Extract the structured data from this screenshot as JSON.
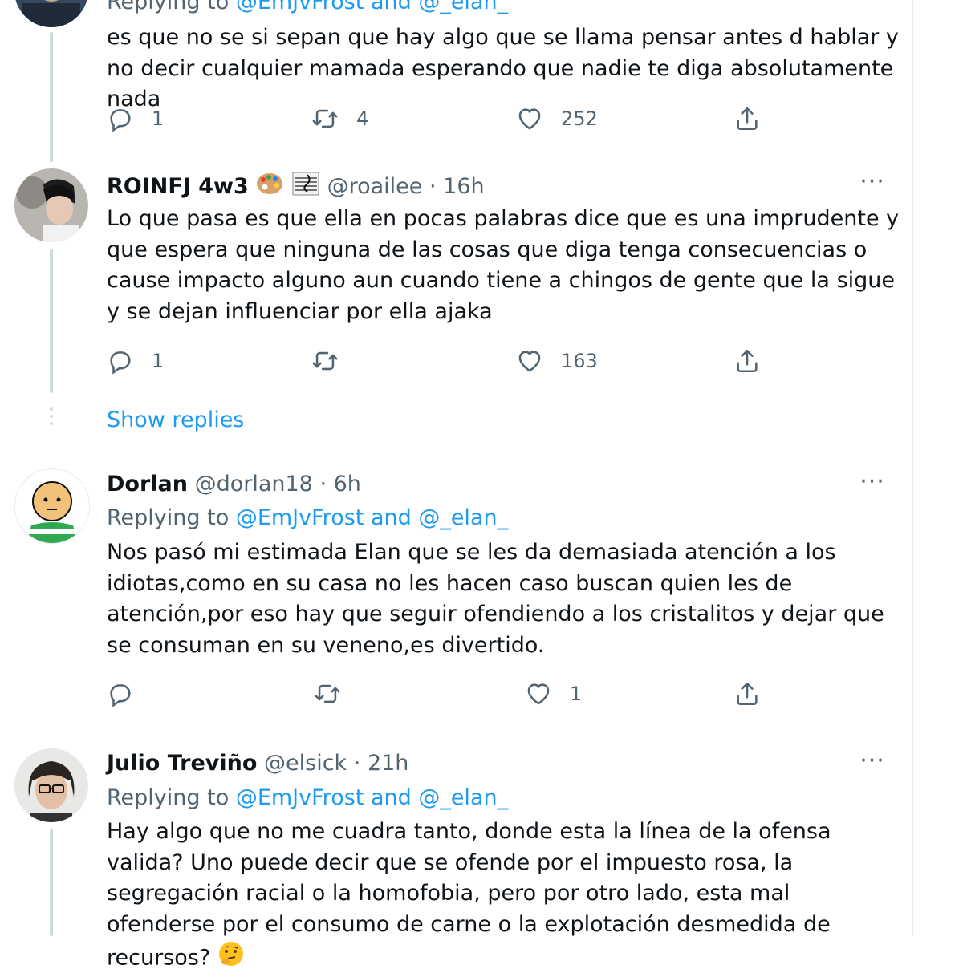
{
  "tweets": [
    {
      "replying_prefix": "Replying to ",
      "replying_to": "@EmJvFrost and @_elan_",
      "text": "es que no se si sepan que hay algo que se llama pensar antes d hablar y no decir cualquier mamada esperando que nadie te diga absolutamente nada",
      "replies": "1",
      "retweets": "4",
      "likes": "252"
    },
    {
      "name": "ROINFJ 4w3",
      "handle": "@roailee",
      "sep": " · ",
      "time": "16h",
      "text": "Lo que pasa es que ella en pocas palabras dice que es una imprudente y que espera que ninguna de las cosas que diga tenga consecuencias o cause impacto alguno aun cuando tiene a chingos de gente que la sigue y se dejan influenciar por ella ajaka",
      "replies": "1",
      "retweets": "",
      "likes": "163",
      "more": "···"
    },
    {
      "name": "Dorlan",
      "handle": "@dorlan18",
      "sep": " · ",
      "time": "6h",
      "replying_prefix": "Replying to ",
      "replying_to": "@EmJvFrost and @_elan_",
      "text": "Nos pasó mi estimada Elan que se les da demasiada atención a los idiotas,como en su casa no les hacen caso buscan quien les de atención,por eso hay que seguir ofendiendo a los cristalitos y dejar que se consuman en su veneno,es divertido.",
      "replies": "",
      "retweets": "",
      "likes": "1",
      "more": "···"
    },
    {
      "name": "Julio Treviño",
      "handle": "@elsick",
      "sep": " · ",
      "time": "21h",
      "replying_prefix": "Replying to ",
      "replying_to": "@EmJvFrost and @_elan_",
      "text": "Hay algo que no me cuadra tanto, donde esta la línea de la ofensa valida? Uno puede decir que se ofende por el impuesto rosa, la segregación racial o la homofobia, pero por otro lado, esta mal ofenderse por el consumo de carne o la explotación desmedida de recursos?",
      "more": "···"
    }
  ],
  "show_replies": "Show replies",
  "colors": {
    "accent": "#1d9bf0",
    "muted": "#536471",
    "text": "#0f1419",
    "border": "#e6ecf0"
  },
  "icons": [
    "reply-icon",
    "retweet-icon",
    "like-icon",
    "share-icon",
    "more-icon",
    "palette-emoji",
    "music-score-emoji",
    "thinking-face-emoji"
  ]
}
